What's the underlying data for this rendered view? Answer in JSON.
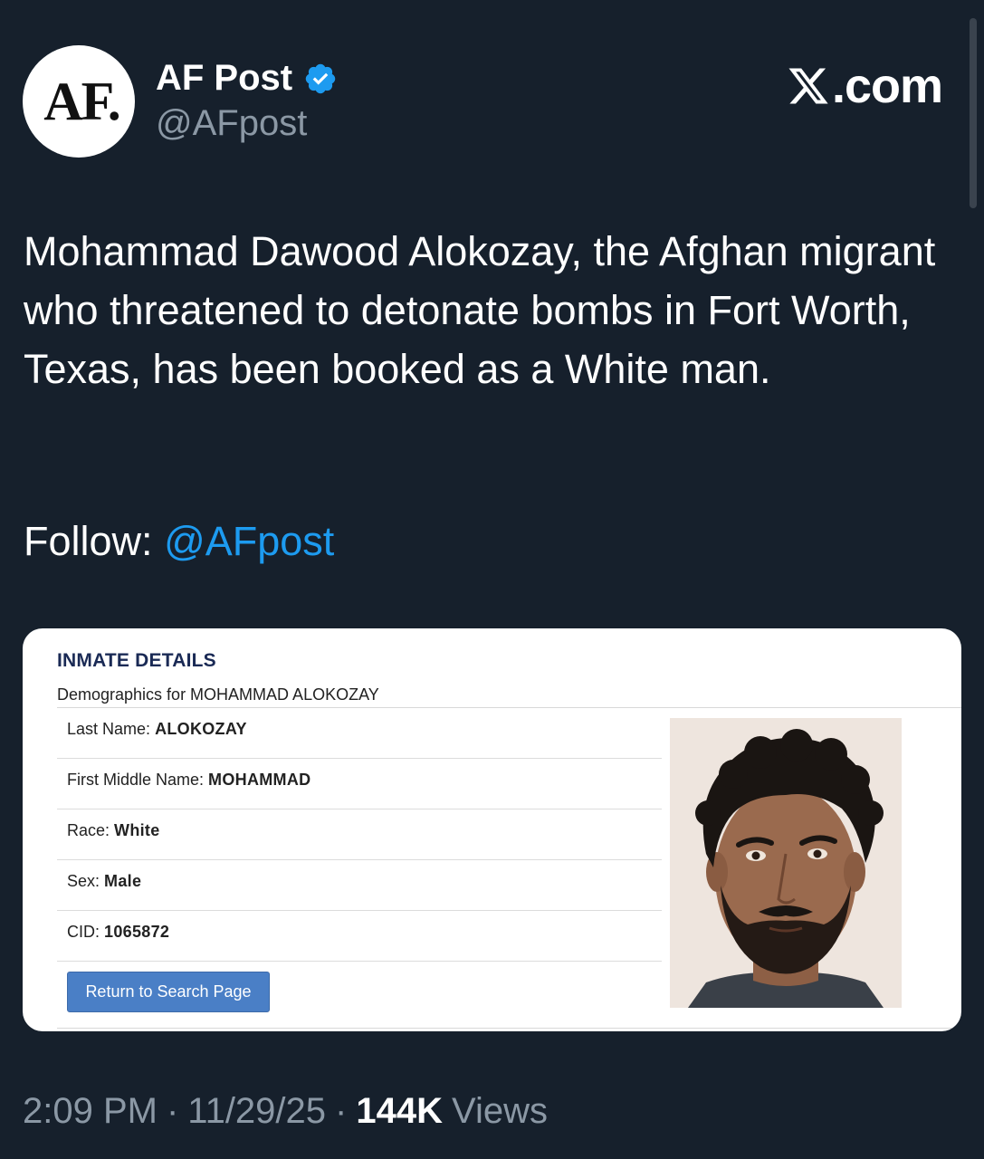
{
  "author": {
    "display_name": "AF Post",
    "handle": "@AFpost",
    "avatar_text": "AF.",
    "verified": true
  },
  "brand": {
    "label": ".com",
    "icon": "x-logo-icon"
  },
  "tweet": {
    "text": "Mohammad Dawood Alokozay, the Afghan migrant who threatened to detonate bombs in Fort Worth, Texas, has been booked as a White man.",
    "follow_label": "Follow:",
    "follow_link": "@AFpost"
  },
  "media": {
    "title": "INMATE DETAILS",
    "subtitle": "Demographics for MOHAMMAD ALOKOZAY",
    "fields": [
      {
        "label": "Last Name:",
        "value": "ALOKOZAY"
      },
      {
        "label": "First Middle Name:",
        "value": "MOHAMMAD"
      },
      {
        "label": "Race:",
        "value": "White"
      },
      {
        "label": "Sex:",
        "value": "Male"
      },
      {
        "label": "CID:",
        "value": "1065872"
      }
    ],
    "return_button": "Return to Search Page"
  },
  "meta": {
    "time": "2:09 PM",
    "date": "11/29/25",
    "separator": "·",
    "views_count": "144K",
    "views_label": "Views"
  },
  "colors": {
    "background": "#16202c",
    "link": "#1d9bf0",
    "verified": "#1d9bf0",
    "muted": "#8b98a5",
    "button": "#4a7fc6"
  }
}
